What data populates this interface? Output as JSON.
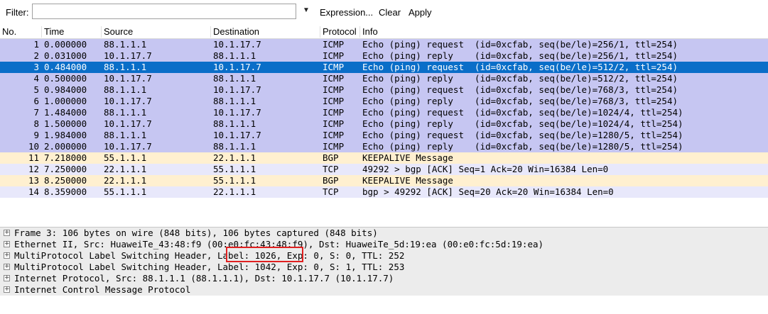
{
  "filter": {
    "label": "Filter:",
    "value": "",
    "placeholder": "",
    "expression_label": "Expression...",
    "clear_label": "Clear",
    "apply_label": "Apply"
  },
  "columns": [
    "No.",
    "Time",
    "Source",
    "Destination",
    "Protocol",
    "Info"
  ],
  "packets": [
    {
      "no": "1",
      "time": "0.000000",
      "src": "88.1.1.1",
      "dst": "10.1.17.7",
      "proto": "ICMP",
      "info": "Echo (ping) request  (id=0xcfab, seq(be/le)=256/1, ttl=254)"
    },
    {
      "no": "2",
      "time": "0.031000",
      "src": "10.1.17.7",
      "dst": "88.1.1.1",
      "proto": "ICMP",
      "info": "Echo (ping) reply    (id=0xcfab, seq(be/le)=256/1, ttl=254)"
    },
    {
      "no": "3",
      "time": "0.484000",
      "src": "88.1.1.1",
      "dst": "10.1.17.7",
      "proto": "ICMP",
      "info": "Echo (ping) request  (id=0xcfab, seq(be/le)=512/2, ttl=254)"
    },
    {
      "no": "4",
      "time": "0.500000",
      "src": "10.1.17.7",
      "dst": "88.1.1.1",
      "proto": "ICMP",
      "info": "Echo (ping) reply    (id=0xcfab, seq(be/le)=512/2, ttl=254)"
    },
    {
      "no": "5",
      "time": "0.984000",
      "src": "88.1.1.1",
      "dst": "10.1.17.7",
      "proto": "ICMP",
      "info": "Echo (ping) request  (id=0xcfab, seq(be/le)=768/3, ttl=254)"
    },
    {
      "no": "6",
      "time": "1.000000",
      "src": "10.1.17.7",
      "dst": "88.1.1.1",
      "proto": "ICMP",
      "info": "Echo (ping) reply    (id=0xcfab, seq(be/le)=768/3, ttl=254)"
    },
    {
      "no": "7",
      "time": "1.484000",
      "src": "88.1.1.1",
      "dst": "10.1.17.7",
      "proto": "ICMP",
      "info": "Echo (ping) request  (id=0xcfab, seq(be/le)=1024/4, ttl=254)"
    },
    {
      "no": "8",
      "time": "1.500000",
      "src": "10.1.17.7",
      "dst": "88.1.1.1",
      "proto": "ICMP",
      "info": "Echo (ping) reply    (id=0xcfab, seq(be/le)=1024/4, ttl=254)"
    },
    {
      "no": "9",
      "time": "1.984000",
      "src": "88.1.1.1",
      "dst": "10.1.17.7",
      "proto": "ICMP",
      "info": "Echo (ping) request  (id=0xcfab, seq(be/le)=1280/5, ttl=254)"
    },
    {
      "no": "10",
      "time": "2.000000",
      "src": "10.1.17.7",
      "dst": "88.1.1.1",
      "proto": "ICMP",
      "info": "Echo (ping) reply    (id=0xcfab, seq(be/le)=1280/5, ttl=254)"
    },
    {
      "no": "11",
      "time": "7.218000",
      "src": "55.1.1.1",
      "dst": "22.1.1.1",
      "proto": "BGP",
      "info": "KEEPALIVE Message"
    },
    {
      "no": "12",
      "time": "7.250000",
      "src": "22.1.1.1",
      "dst": "55.1.1.1",
      "proto": "TCP",
      "info": "49292 > bgp [ACK] Seq=1 Ack=20 Win=16384 Len=0"
    },
    {
      "no": "13",
      "time": "8.250000",
      "src": "22.1.1.1",
      "dst": "55.1.1.1",
      "proto": "BGP",
      "info": "KEEPALIVE Message"
    },
    {
      "no": "14",
      "time": "8.359000",
      "src": "55.1.1.1",
      "dst": "22.1.1.1",
      "proto": "TCP",
      "info": "bgp > 49292 [ACK] Seq=20 Ack=20 Win=16384 Len=0"
    }
  ],
  "selected_packet": "3",
  "details": [
    "Frame 3: 106 bytes on wire (848 bits), 106 bytes captured (848 bits)",
    "Ethernet II, Src: HuaweiTe_43:48:f9 (00:e0:fc:43:48:f9), Dst: HuaweiTe_5d:19:ea (00:e0:fc:5d:19:ea)",
    "MultiProtocol Label Switching Header, Label: 1026, Exp: 0, S: 0, TTL: 252",
    "MultiProtocol Label Switching Header, Label: 1042, Exp: 0, S: 1, TTL: 253",
    "Internet Protocol, Src: 88.1.1.1 (88.1.1.1), Dst: 10.1.17.7 (10.1.17.7)",
    "Internet Control Message Protocol"
  ],
  "expander_symbol": "+",
  "colors": {
    "icmp_row": "#c6c6f2",
    "bgp_row": "#fff0d0",
    "tcp_row": "#e8e8fb",
    "selected_row": "#0a6ec8",
    "annotation_box": "#e02020"
  }
}
